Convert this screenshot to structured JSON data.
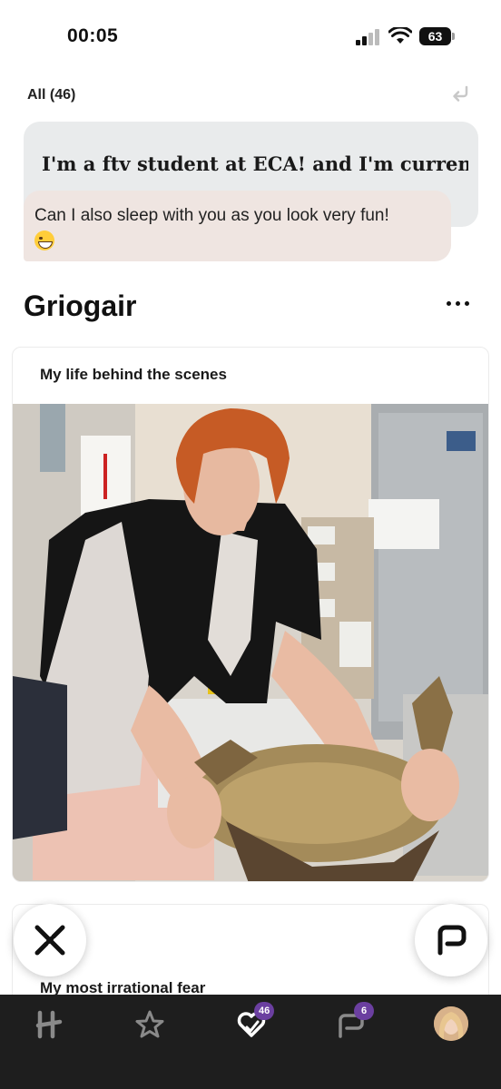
{
  "status_bar": {
    "time": "00:05",
    "battery": "63"
  },
  "filter": {
    "label": "All (46)"
  },
  "quote": {
    "text": "I'm a ftv student at ECA! and I'm curren..."
  },
  "message": {
    "text": "Can I also sleep with you as you look very fun!",
    "emoji": "grinning-sweat-emoji"
  },
  "profile": {
    "name": "Griogair"
  },
  "prompt_card": {
    "title": "My life behind the scenes"
  },
  "next_card": {
    "title": "My most irrational fear"
  },
  "tab_bar": {
    "likes_badge": "46",
    "messages_badge": "6"
  },
  "colors": {
    "tab_bar_bg": "#1e1e1e",
    "badge": "#6b3fa0",
    "quote_bg": "#e9ebec",
    "message_bg": "#efe5e1"
  }
}
